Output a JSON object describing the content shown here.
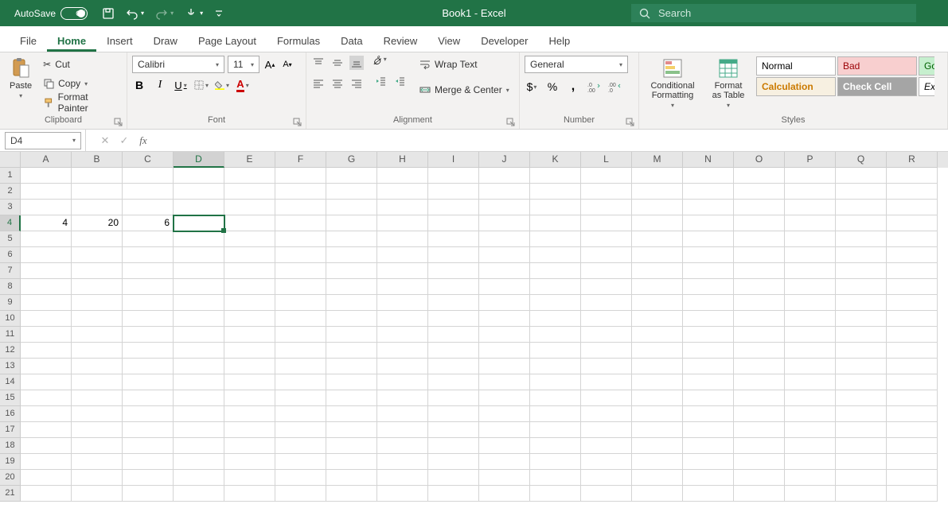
{
  "titlebar": {
    "autosave_label": "AutoSave",
    "autosave_state": "Off",
    "title_doc": "Book1",
    "title_app": "Excel",
    "search_placeholder": "Search"
  },
  "tabs": {
    "file": "File",
    "home": "Home",
    "insert": "Insert",
    "draw": "Draw",
    "page_layout": "Page Layout",
    "formulas": "Formulas",
    "data": "Data",
    "review": "Review",
    "view": "View",
    "developer": "Developer",
    "help": "Help"
  },
  "ribbon": {
    "clipboard": {
      "paste": "Paste",
      "cut": "Cut",
      "copy": "Copy",
      "format_painter": "Format Painter",
      "label": "Clipboard"
    },
    "font": {
      "name": "Calibri",
      "size": "11",
      "label": "Font"
    },
    "alignment": {
      "wrap": "Wrap Text",
      "merge": "Merge & Center",
      "label": "Alignment"
    },
    "number": {
      "format": "General",
      "label": "Number"
    },
    "styles": {
      "cond": "Conditional Formatting",
      "table": "Format as Table",
      "normal": "Normal",
      "bad": "Bad",
      "good_partial": "Go",
      "calculation": "Calculation",
      "check": "Check Cell",
      "explanatory_partial": "Ex",
      "label": "Styles"
    }
  },
  "formula_bar": {
    "name_box": "D4",
    "formula": ""
  },
  "grid": {
    "columns": [
      "A",
      "B",
      "C",
      "D",
      "E",
      "F",
      "G",
      "H",
      "I",
      "J",
      "K",
      "L",
      "M",
      "N",
      "O",
      "P",
      "Q",
      "R"
    ],
    "row_count": 21,
    "active_cell": "D4",
    "active_col_index": 3,
    "active_row_index": 3,
    "cells": {
      "r3": {
        "A": "4",
        "B": "20",
        "C": "6"
      }
    }
  },
  "chart_data": null
}
